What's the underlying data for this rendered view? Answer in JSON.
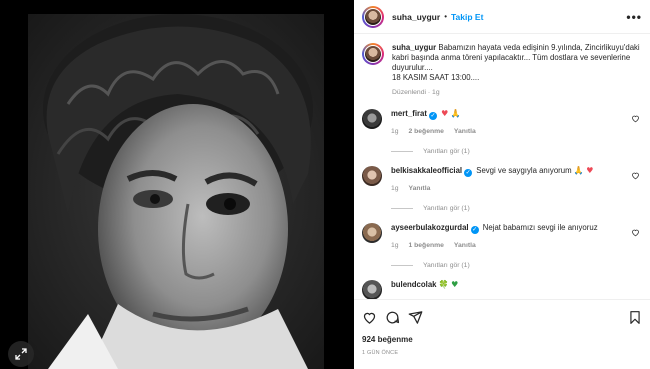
{
  "post": {
    "username": "suha_uygur",
    "separator": "•",
    "follow_label": "Takip Et",
    "more_label": "•••",
    "caption": "Babamızın hayata veda edişinin 9.yılında, Zincirlikuyu'daki kabri başında anma töreni yapılacaktır... Tüm dostlara ve sevenlerine duyurulur....",
    "caption_line2": "18 KASIM SAAT 13:00....",
    "caption_meta": "Düzenlendi · 1g"
  },
  "comments": [
    {
      "username": "mert_firat",
      "text": "",
      "emojis": "♥ 🙏",
      "time": "1g",
      "likes": "2 beğenme",
      "reply": "Yanıtla",
      "view_replies": "Yanıtları gör (1)"
    },
    {
      "username": "belkisakkaleofficial",
      "text": "Sevgi ve saygıyla anıyorum",
      "emojis": "🙏 ♥",
      "time": "1g",
      "likes": "",
      "reply": "Yanıtla",
      "view_replies": "Yanıtları gör (1)"
    },
    {
      "username": "ayseerbulakozgurdal",
      "text": "Nejat babamızı sevgi ile anıyoruz",
      "emojis": "",
      "time": "1g",
      "likes": "1 beğenme",
      "reply": "Yanıtla",
      "view_replies": "Yanıtları gör (1)"
    },
    {
      "username": "bulendcolak",
      "text": "",
      "emojis": "🍀 ♥",
      "time": "",
      "likes": "",
      "reply": "",
      "view_replies": ""
    }
  ],
  "footer": {
    "likes": "924 beğenme",
    "time": "1 GÜN ÖNCE"
  },
  "icons": {
    "like": "heart-icon",
    "comment": "comment-icon",
    "share": "share-icon",
    "save": "bookmark-icon",
    "expand": "expand-icon"
  },
  "colors": {
    "accent": "#0095f6",
    "heart": "#ed4956",
    "muted": "#8e8e8e"
  }
}
